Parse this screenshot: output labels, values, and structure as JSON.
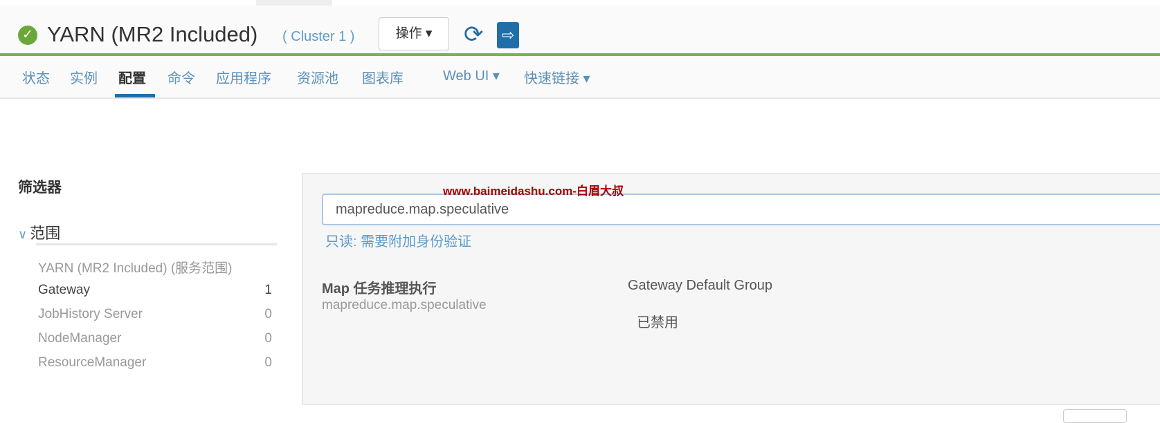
{
  "header": {
    "title": "YARN (MR2 Included)",
    "cluster": "( Cluster 1 )",
    "actions_label": "操作 ▾",
    "status": "good",
    "accent_color": "#7ab545"
  },
  "nav": {
    "tabs": [
      {
        "label": "状态"
      },
      {
        "label": "实例"
      },
      {
        "label": "配置",
        "active": true
      },
      {
        "label": "命令"
      },
      {
        "label": "应用程序"
      },
      {
        "label": "资源池"
      },
      {
        "label": "图表库"
      },
      {
        "label": "Web UI ▾"
      },
      {
        "label": "快速链接 ▾"
      }
    ]
  },
  "filter": {
    "title": "筛选器",
    "scope_label": "范围",
    "items": [
      {
        "label": "YARN (MR2 Included) (服务范围)",
        "count": ""
      },
      {
        "label": "Gateway",
        "count": "1"
      },
      {
        "label": "JobHistory Server",
        "count": "0"
      },
      {
        "label": "NodeManager",
        "count": "0"
      },
      {
        "label": "ResourceManager",
        "count": "0"
      }
    ]
  },
  "search": {
    "value": "mapreduce.map.speculative"
  },
  "watermark": "www.baimeidashu.com-白眉大叔",
  "readonly_note": "只读: 需要附加身份验证",
  "property": {
    "name": "Map 任务推理执行",
    "key": "mapreduce.map.speculative",
    "group": "Gateway Default Group",
    "value": "已禁用"
  }
}
